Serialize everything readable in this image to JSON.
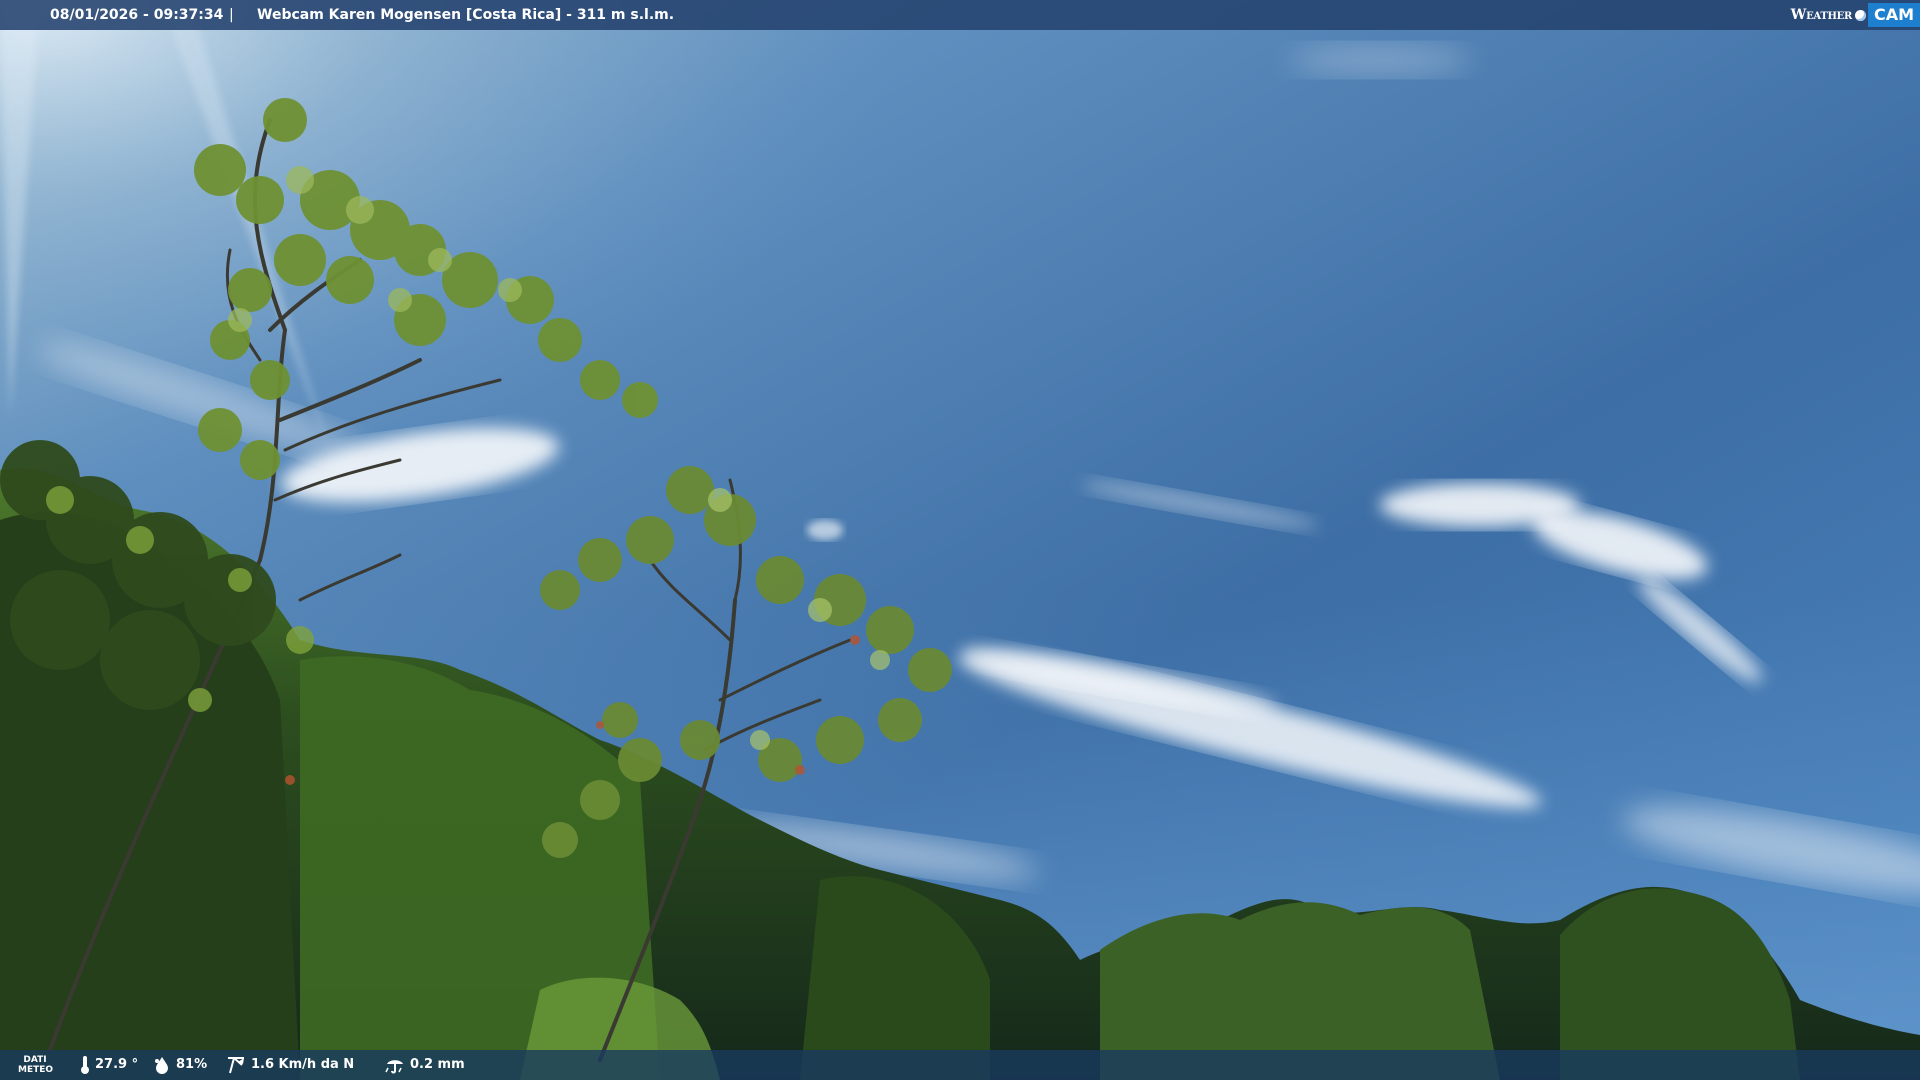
{
  "top_bar": {
    "timestamp": "08/01/2026 - 09:37:34",
    "separator": "|",
    "title": "Webcam Karen Mogensen [Costa Rica]  - 311 m s.l.m."
  },
  "logo": {
    "weather": "Weather",
    "cam": "CAM"
  },
  "bottom_bar": {
    "meteo_label_line1": "DATI",
    "meteo_label_line2": "METEO",
    "temperature": "27.9 °",
    "humidity": "81%",
    "wind": "1.6 Km/h da N",
    "rain": "0.2 mm"
  },
  "colors": {
    "sky_top": "#3f6f9f",
    "sky_horizon": "#5b8fc4",
    "foliage_dark": "#1e3a1a",
    "foliage_light": "#6f9a3a",
    "bar": "#24426e",
    "logo_accent": "#1f7fcf"
  },
  "icons": [
    "thermometer-icon",
    "humidity-drop-icon",
    "wind-icon",
    "rain-gauge-icon",
    "weather-cam-logo"
  ]
}
